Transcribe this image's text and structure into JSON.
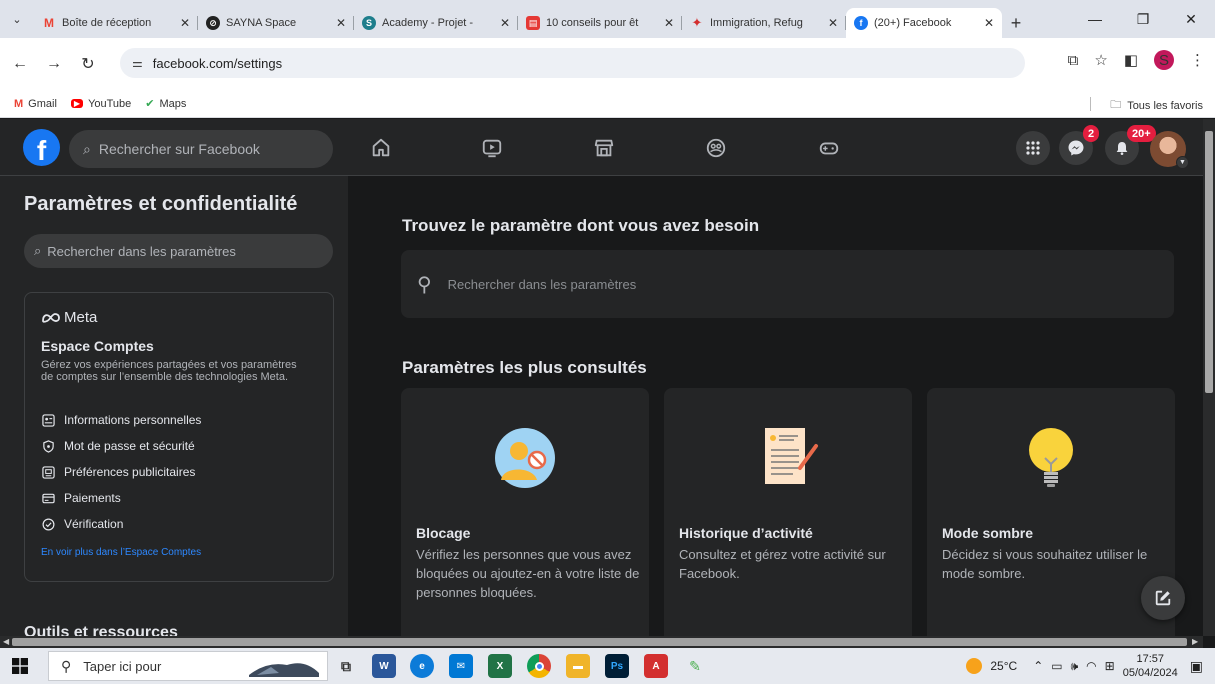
{
  "browser": {
    "tabs": [
      {
        "title": "Boîte de réception",
        "icon": "gmail-icon",
        "color": "#ea4335"
      },
      {
        "title": "SAYNA Space",
        "icon": "sayna-icon",
        "color": "#222222"
      },
      {
        "title": "Academy - Projet -",
        "icon": "academy-icon",
        "color": "#1e7e8c"
      },
      {
        "title": "10 conseils pour êt",
        "icon": "article-icon",
        "color": "#e53935"
      },
      {
        "title": "Immigration, Refug",
        "icon": "maple-leaf-icon",
        "color": "#d32f2f"
      },
      {
        "title": "(20+) Facebook",
        "icon": "facebook-icon",
        "color": "#1877f2"
      }
    ],
    "url": "facebook.com/settings",
    "profile_initial": "S",
    "bookmarks": [
      {
        "label": "Gmail",
        "icon": "gmail-icon"
      },
      {
        "label": "YouTube",
        "icon": "youtube-icon"
      },
      {
        "label": "Maps",
        "icon": "maps-icon"
      }
    ],
    "all_bookmarks": "Tous les favoris"
  },
  "facebook": {
    "search_placeholder": "Rechercher sur Facebook",
    "messenger_badge": "2",
    "notifications_badge": "20+"
  },
  "sidebar": {
    "title": "Paramètres et confidentialité",
    "search_placeholder": "Rechercher dans les paramètres",
    "meta_label": "Meta",
    "accounts": {
      "title": "Espace Comptes",
      "description": "Gérez vos expériences partagées et vos paramètres de comptes sur l’ensemble des technologies Meta.",
      "items": [
        {
          "label": "Informations personnelles",
          "icon": "id-card-icon"
        },
        {
          "label": "Mot de passe et sécurité",
          "icon": "shield-icon"
        },
        {
          "label": "Préférences publicitaires",
          "icon": "ad-preferences-icon"
        },
        {
          "label": "Paiements",
          "icon": "credit-card-icon"
        },
        {
          "label": "Vérification",
          "icon": "verified-check-icon"
        }
      ],
      "more_link": "En voir plus dans l’Espace Comptes"
    },
    "tools_title": "Outils et ressources"
  },
  "main": {
    "title": "Trouvez le paramètre dont vous avez besoin",
    "search_placeholder": "Rechercher dans les paramètres",
    "section_title": "Paramètres les plus consultés",
    "tiles": [
      {
        "title": "Blocage",
        "description": "Vérifiez les personnes que vous avez bloquées ou ajoutez-en à votre liste de personnes bloquées.",
        "icon": "blocked-people-icon"
      },
      {
        "title": "Historique d’activité",
        "description": "Consultez et gérez votre activité sur Facebook.",
        "icon": "activity-log-icon"
      },
      {
        "title": "Mode sombre",
        "description": "Décidez si vous souhaitez utiliser le mode sombre.",
        "icon": "lightbulb-icon"
      }
    ]
  },
  "taskbar": {
    "search_placeholder": "Taper ici pour",
    "weather": "25°C",
    "time": "17:57",
    "date": "05/04/2024"
  },
  "colors": {
    "fb_blue": "#1877f2",
    "dark_bg": "#18191a",
    "surface": "#242526",
    "badge_red": "#e41e3f"
  }
}
